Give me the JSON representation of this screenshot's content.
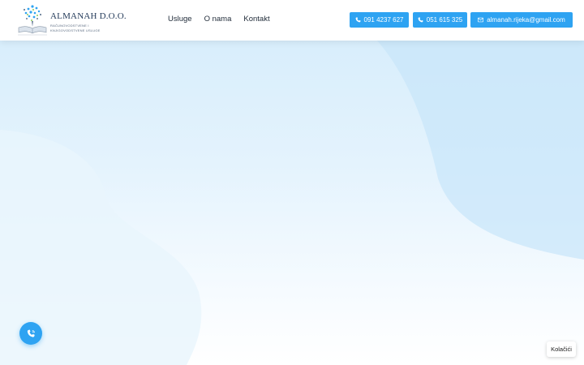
{
  "brand": {
    "name": "ALMANAH D.O.O.",
    "subtitle_line1": "RAČUNOVODSTVENE I",
    "subtitle_line2": "KNJIGOVODSTVENE USLUGE"
  },
  "nav": {
    "links": [
      "Usluge",
      "O nama",
      "Kontakt"
    ]
  },
  "contact": {
    "phone1": "091 4237 627",
    "phone2": "051 615 325",
    "email": "almanah.rijeka@gmail.com"
  },
  "cookies": {
    "label": "Kolačići"
  },
  "icons": {
    "phone": "phone-icon",
    "email": "envelope-icon",
    "fab": "phone-icon"
  },
  "colors": {
    "accent": "#2ea3f2",
    "brand_text": "#243b5a",
    "hero_top": "#d4ecfb"
  }
}
